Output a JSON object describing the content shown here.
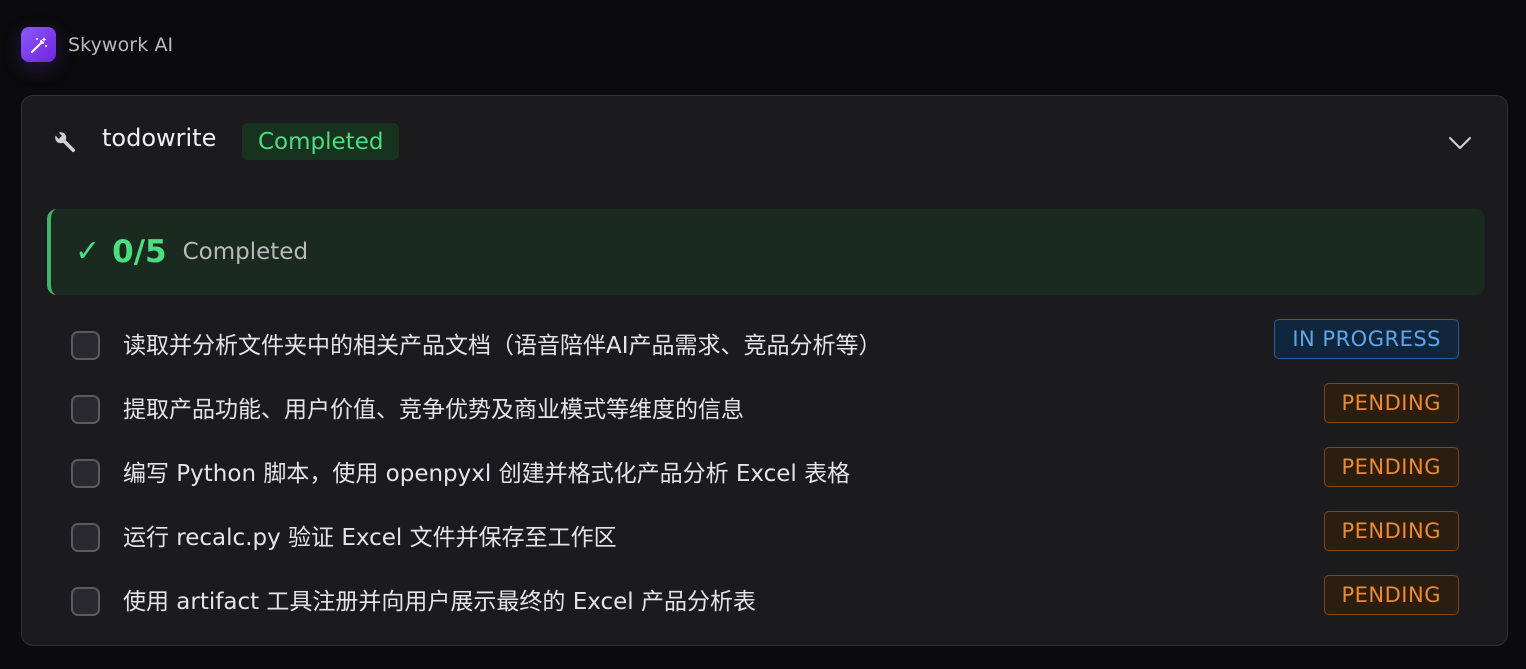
{
  "app": {
    "title": "Skywork AI",
    "logo_icon": "magic-wand-icon"
  },
  "tool_card": {
    "icon": "wrench-icon",
    "name": "todowrite",
    "status": "Completed",
    "toggle_icon": "chevron-down-icon"
  },
  "summary": {
    "icon": "checkmark-icon",
    "count": "0/5",
    "label": "Completed"
  },
  "todos": [
    {
      "text": "读取并分析文件夹中的相关产品文档（语音陪伴AI产品需求、竞品分析等）",
      "status": "IN PROGRESS"
    },
    {
      "text": "提取产品功能、用户价值、竞争优势及商业模式等维度的信息",
      "status": "PENDING"
    },
    {
      "text": "编写 Python 脚本，使用 openpyxl 创建并格式化产品分析 Excel 表格",
      "status": "PENDING"
    },
    {
      "text": "运行 recalc.py 验证 Excel 文件并保存至工作区",
      "status": "PENDING"
    },
    {
      "text": "使用 artifact 工具注册并向用户展示最终的 Excel 产品分析表",
      "status": "PENDING"
    }
  ],
  "colors": {
    "accent_purple": "#7c3aed",
    "success_green": "#4ade80",
    "in_progress_blue": "#5fa5ea",
    "pending_orange": "#f08a2e"
  }
}
